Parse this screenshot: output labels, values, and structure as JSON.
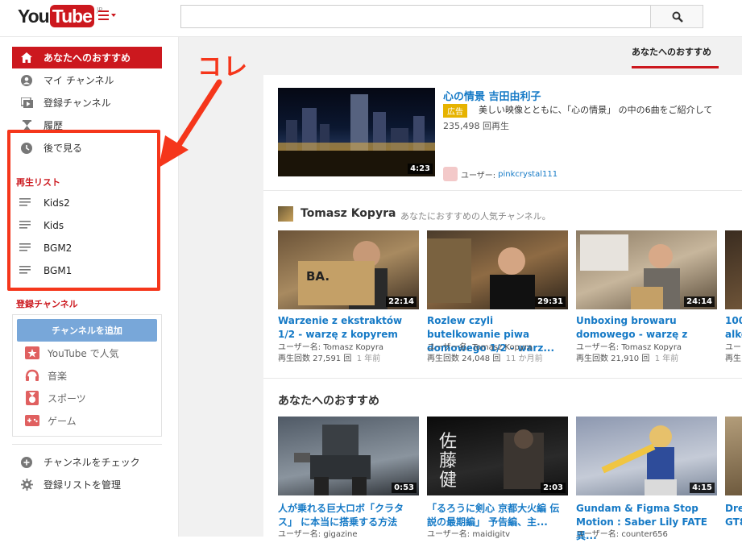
{
  "header": {
    "logo_you": "You",
    "logo_tube": "Tube",
    "logo_region": "JP",
    "search_placeholder": ""
  },
  "sidebar": {
    "nav": [
      {
        "label": "あなたへのおすすめ",
        "icon": "home-icon",
        "active": true
      },
      {
        "label": "マイ チャンネル",
        "icon": "user-icon",
        "active": false
      },
      {
        "label": "登録チャンネル",
        "icon": "subscriptions-icon",
        "active": false
      },
      {
        "label": "履歴",
        "icon": "history-icon",
        "active": false
      },
      {
        "label": "後で見る",
        "icon": "clock-icon",
        "active": false
      }
    ],
    "playlist_title": "再生リスト",
    "playlists": [
      "Kids2",
      "Kids",
      "BGM2",
      "BGM1"
    ],
    "subscriptions_title": "登録チャンネル",
    "add_channel_label": "チャンネルを追加",
    "channels": [
      {
        "label": "YouTube で人気",
        "icon": "popular-icon"
      },
      {
        "label": "音楽",
        "icon": "music-icon"
      },
      {
        "label": "スポーツ",
        "icon": "sports-icon"
      },
      {
        "label": "ゲーム",
        "icon": "games-icon"
      }
    ],
    "footer": [
      {
        "label": "チャンネルをチェック",
        "icon": "plus-circle-icon"
      },
      {
        "label": "登録リストを管理",
        "icon": "gear-icon"
      }
    ]
  },
  "annotation": {
    "text": "コレ",
    "color": "#f5361b"
  },
  "tabs": {
    "active": "あなたへのおすすめ"
  },
  "ad": {
    "title": "心の情景 吉田由利子",
    "badge": "広告",
    "description": "美しい映像とともに、「心の情景」 の中の6曲をご紹介して",
    "views": "235,498 回再生",
    "user_prefix": "ユーザー:",
    "user": "pinkcrystal111",
    "duration": "4:23"
  },
  "channel_section": {
    "name": "Tomasz Kopyra",
    "subtitle": "あなたにおすすめの人気チャンネル。",
    "videos": [
      {
        "title": "Warzenie z ekstraktów 1/2 - warzę z kopyrem",
        "user": "ユーザー名: Tomasz Kopyra",
        "views": "再生回数 27,591 回",
        "age": "1 年前",
        "duration": "22:14"
      },
      {
        "title": "Rozlew czyli butelkowanie piwa domowego 1/2 - warz...",
        "user": "ユーザー名: Tomasz Kopyra",
        "views": "再生回数 24,048 回",
        "age": "11 か月前",
        "duration": "29:31"
      },
      {
        "title": "Unboxing browaru domowego - warzę z",
        "user": "ユーザー名: Tomasz Kopyra",
        "views": "再生回数 21,910 回",
        "age": "1 年前",
        "duration": "24:14"
      },
      {
        "title": "100 alko",
        "user": "ユー",
        "views": "再生",
        "age": "",
        "duration": ""
      }
    ]
  },
  "recommend_section": {
    "title": "あなたへのおすすめ",
    "videos": [
      {
        "title": "人が乗れる巨大ロボ「クラタス」 に本当に搭乗する方法",
        "user": "ユーザー名: gigazine",
        "duration": "0:53"
      },
      {
        "title": "「るろうに剣心 京都大火編 伝説の最期編」 予告編、主...",
        "user": "ユーザー名: maidigitv",
        "duration": "2:03"
      },
      {
        "title": "Gundam & Figma Stop Motion : Saber Lily FATE異...",
        "user": "ユーザー名: counter656",
        "duration": "4:15"
      },
      {
        "title": "Dre GT8",
        "user": "",
        "duration": ""
      }
    ]
  }
}
